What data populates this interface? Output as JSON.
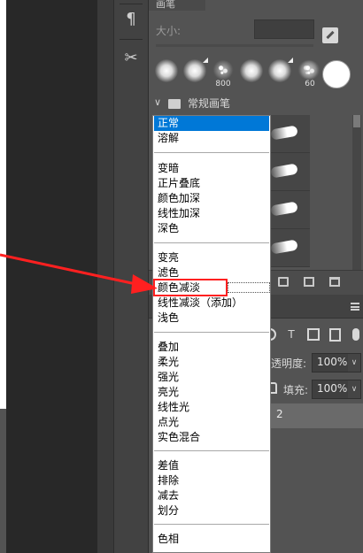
{
  "brush_panel": {
    "tab_title": "画笔",
    "size_label": "大小:",
    "presets": [
      {
        "number": ""
      },
      {
        "number": ""
      },
      {
        "number": "800"
      },
      {
        "number": ""
      },
      {
        "number": ""
      },
      {
        "number": ""
      },
      {
        "number": "60"
      }
    ],
    "group_name": "常规画笔"
  },
  "blend_menu": {
    "groups": [
      [
        "正常",
        "溶解"
      ],
      [
        "变暗",
        "正片叠底",
        "颜色加深",
        "线性加深",
        "深色"
      ],
      [
        "变亮",
        "滤色",
        "颜色减淡",
        "线性减淡（添加）",
        "浅色"
      ],
      [
        "叠加",
        "柔光",
        "强光",
        "亮光",
        "线性光",
        "点光",
        "实色混合"
      ],
      [
        "差值",
        "排除",
        "减去",
        "划分"
      ],
      [
        "色相"
      ]
    ],
    "selected": "正常",
    "highlighted": "颜色减淡"
  },
  "layers_panel": {
    "opacity_label": "透明度:",
    "opacity_value": "100%",
    "fill_label": "填充:",
    "fill_value": "100%",
    "layer_name": "2"
  },
  "colors": {
    "annotation_red": "#ff2020",
    "selection_blue": "#0078d7",
    "panel_bg": "#535353"
  }
}
